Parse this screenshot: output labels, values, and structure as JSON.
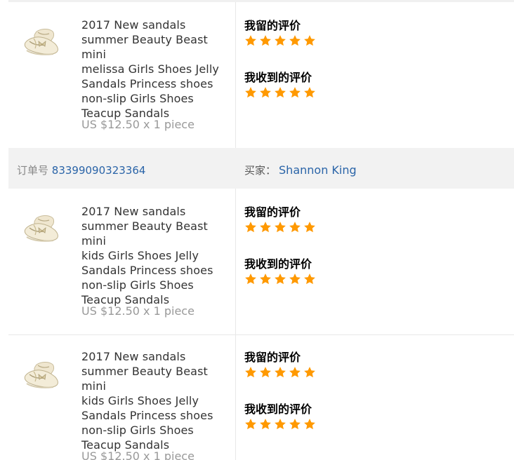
{
  "orders": {
    "order_label": "订单号",
    "order_number": "83399090323364",
    "buyer_label": "买家：",
    "buyer_name": "Shannon King"
  },
  "items": [
    {
      "title_lines": [
        "2017 New sandals",
        "summer Beauty Beast mini",
        "melissa Girls Shoes Jelly",
        "Sandals Princess shoes",
        "non-slip Girls Shoes",
        "Teacup Sandals"
      ],
      "price": "US $12.50 x 1 piece",
      "my_review_label": "我留的评价",
      "my_review_stars": 5,
      "received_review_label": "我收到的评价",
      "received_review_stars": 5
    },
    {
      "title_lines": [
        "2017 New sandals",
        "summer Beauty Beast mini",
        "kids Girls Shoes Jelly",
        "Sandals Princess shoes",
        "non-slip Girls Shoes",
        "Teacup Sandals"
      ],
      "price": "US $12.50 x 1 piece",
      "my_review_label": "我留的评价",
      "my_review_stars": 5,
      "received_review_label": "我收到的评价",
      "received_review_stars": 5
    },
    {
      "title_lines": [
        "2017 New sandals",
        "summer Beauty Beast mini",
        "kids Girls Shoes Jelly",
        "Sandals Princess shoes",
        "non-slip Girls Shoes",
        "Teacup Sandals"
      ],
      "price": "US $12.50 x 1 piece",
      "my_review_label": "我留的评价",
      "my_review_stars": 5,
      "received_review_label": "我收到的评价",
      "received_review_stars": 5
    }
  ],
  "colors": {
    "star": "#ff9900",
    "link": "#2a64a8",
    "order_bar_bg": "#f2f2f2"
  },
  "icons": {
    "product_thumbnail": "sandal-shoe-icon",
    "rating_star": "star-icon"
  }
}
